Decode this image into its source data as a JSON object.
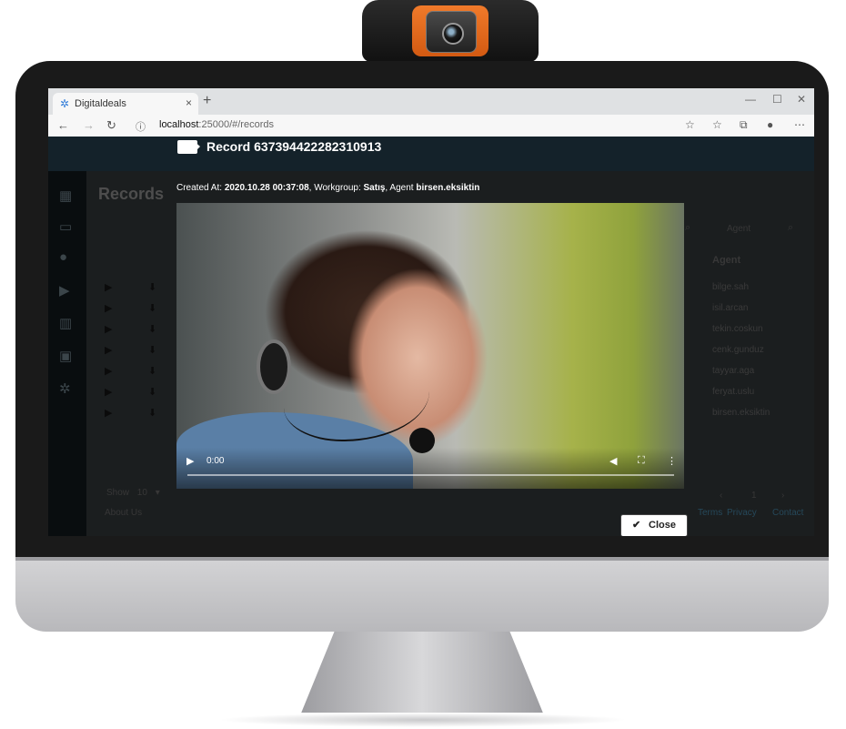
{
  "browser": {
    "tab_title": "Digitaldeals",
    "tab_close": "×",
    "new_tab": "+",
    "url_host": "localhost",
    "url_path": ":25000/#/records"
  },
  "app": {
    "page_title": "Records",
    "agent_header": "Agent",
    "agent_search_placeholder": "Agent",
    "agents": [
      "bilge.sah",
      "isil.arcan",
      "tekin.coskun",
      "cenk.gunduz",
      "tayyar.aga",
      "feryat.uslu",
      "birsen.eksiktin"
    ],
    "show_label": "Show",
    "show_value": "10",
    "page_current": "1",
    "footer_about": "About Us",
    "footer_links": [
      "Terms",
      "Privacy",
      "Contact"
    ]
  },
  "modal": {
    "title": "Record 637394422282310913",
    "created_label": "Created At:",
    "created_value": "2020.10.28 00:37:08",
    "workgroup_label": ", Workgroup:",
    "workgroup_value": "Satış",
    "agent_label": ", Agent",
    "agent_value": "birsen.eksiktin",
    "video_time": "0:00",
    "close_label": "Close"
  },
  "icons": {
    "favicon": "gear-icon",
    "back": "arrow-left-icon",
    "forward": "arrow-right-icon",
    "refresh": "refresh-icon",
    "info": "info-icon",
    "star": "star-icon",
    "favorites": "favorites-icon",
    "collections": "collections-icon",
    "profile": "profile-icon",
    "more": "more-icon",
    "play": "play-icon",
    "download": "download-icon",
    "camera": "video-camera-icon",
    "check": "check-icon"
  }
}
